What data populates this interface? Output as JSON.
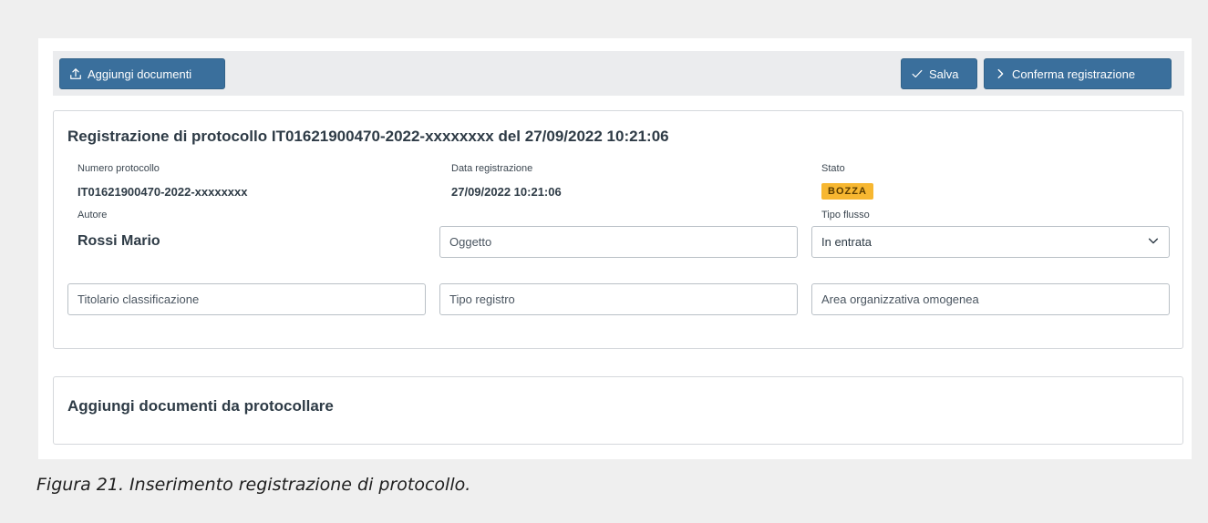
{
  "toolbar": {
    "add_documents_label": "Aggiungi documenti",
    "save_label": "Salva",
    "confirm_label": "Conferma registrazione"
  },
  "registration": {
    "title": "Registrazione di protocollo IT01621900470-2022-xxxxxxxx del 27/09/2022 10:21:06",
    "numero_protocollo_label": "Numero protocollo",
    "numero_protocollo_value": "IT01621900470-2022-xxxxxxxx",
    "data_registrazione_label": "Data registrazione",
    "data_registrazione_value": "27/09/2022 10:21:06",
    "stato_label": "Stato",
    "stato_value": "BOZZA",
    "autore_label": "Autore",
    "autore_value": "Rossi Mario",
    "tipo_flusso_label": "Tipo flusso",
    "oggetto_placeholder": "Oggetto",
    "tipo_flusso_value": "In entrata",
    "titolario_placeholder": "Titolario classificazione",
    "tipo_registro_placeholder": "Tipo registro",
    "area_placeholder": "Area organizzativa omogenea"
  },
  "documents_section": {
    "title": "Aggiungi documenti da protocollare"
  },
  "caption": "Figura 21. Inserimento registrazione di protocollo.",
  "colors": {
    "primary_button": "#3a6f9c",
    "badge": "#f7b731",
    "toolbar_bg": "#ebecee"
  },
  "icons": {
    "add_documents": "upload-icon",
    "save": "check-icon",
    "confirm": "chevron-right-icon",
    "select": "chevron-down-icon"
  }
}
